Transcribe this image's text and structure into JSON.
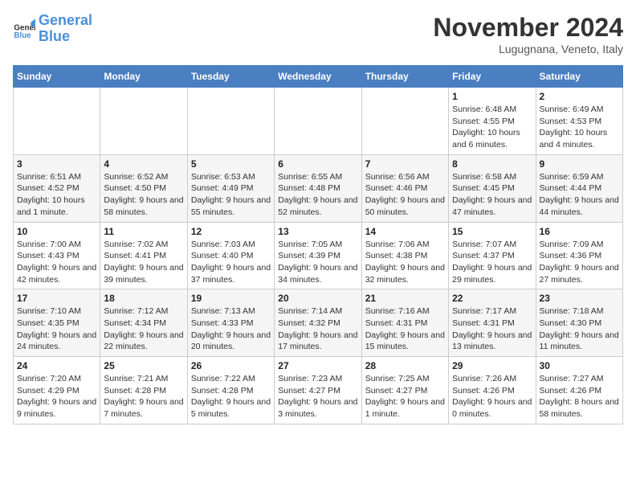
{
  "logo": {
    "text_general": "General",
    "text_blue": "Blue"
  },
  "header": {
    "month": "November 2024",
    "location": "Lugugnana, Veneto, Italy"
  },
  "weekdays": [
    "Sunday",
    "Monday",
    "Tuesday",
    "Wednesday",
    "Thursday",
    "Friday",
    "Saturday"
  ],
  "weeks": [
    [
      {
        "day": "",
        "info": ""
      },
      {
        "day": "",
        "info": ""
      },
      {
        "day": "",
        "info": ""
      },
      {
        "day": "",
        "info": ""
      },
      {
        "day": "",
        "info": ""
      },
      {
        "day": "1",
        "info": "Sunrise: 6:48 AM\nSunset: 4:55 PM\nDaylight: 10 hours and 6 minutes."
      },
      {
        "day": "2",
        "info": "Sunrise: 6:49 AM\nSunset: 4:53 PM\nDaylight: 10 hours and 4 minutes."
      }
    ],
    [
      {
        "day": "3",
        "info": "Sunrise: 6:51 AM\nSunset: 4:52 PM\nDaylight: 10 hours and 1 minute."
      },
      {
        "day": "4",
        "info": "Sunrise: 6:52 AM\nSunset: 4:50 PM\nDaylight: 9 hours and 58 minutes."
      },
      {
        "day": "5",
        "info": "Sunrise: 6:53 AM\nSunset: 4:49 PM\nDaylight: 9 hours and 55 minutes."
      },
      {
        "day": "6",
        "info": "Sunrise: 6:55 AM\nSunset: 4:48 PM\nDaylight: 9 hours and 52 minutes."
      },
      {
        "day": "7",
        "info": "Sunrise: 6:56 AM\nSunset: 4:46 PM\nDaylight: 9 hours and 50 minutes."
      },
      {
        "day": "8",
        "info": "Sunrise: 6:58 AM\nSunset: 4:45 PM\nDaylight: 9 hours and 47 minutes."
      },
      {
        "day": "9",
        "info": "Sunrise: 6:59 AM\nSunset: 4:44 PM\nDaylight: 9 hours and 44 minutes."
      }
    ],
    [
      {
        "day": "10",
        "info": "Sunrise: 7:00 AM\nSunset: 4:43 PM\nDaylight: 9 hours and 42 minutes."
      },
      {
        "day": "11",
        "info": "Sunrise: 7:02 AM\nSunset: 4:41 PM\nDaylight: 9 hours and 39 minutes."
      },
      {
        "day": "12",
        "info": "Sunrise: 7:03 AM\nSunset: 4:40 PM\nDaylight: 9 hours and 37 minutes."
      },
      {
        "day": "13",
        "info": "Sunrise: 7:05 AM\nSunset: 4:39 PM\nDaylight: 9 hours and 34 minutes."
      },
      {
        "day": "14",
        "info": "Sunrise: 7:06 AM\nSunset: 4:38 PM\nDaylight: 9 hours and 32 minutes."
      },
      {
        "day": "15",
        "info": "Sunrise: 7:07 AM\nSunset: 4:37 PM\nDaylight: 9 hours and 29 minutes."
      },
      {
        "day": "16",
        "info": "Sunrise: 7:09 AM\nSunset: 4:36 PM\nDaylight: 9 hours and 27 minutes."
      }
    ],
    [
      {
        "day": "17",
        "info": "Sunrise: 7:10 AM\nSunset: 4:35 PM\nDaylight: 9 hours and 24 minutes."
      },
      {
        "day": "18",
        "info": "Sunrise: 7:12 AM\nSunset: 4:34 PM\nDaylight: 9 hours and 22 minutes."
      },
      {
        "day": "19",
        "info": "Sunrise: 7:13 AM\nSunset: 4:33 PM\nDaylight: 9 hours and 20 minutes."
      },
      {
        "day": "20",
        "info": "Sunrise: 7:14 AM\nSunset: 4:32 PM\nDaylight: 9 hours and 17 minutes."
      },
      {
        "day": "21",
        "info": "Sunrise: 7:16 AM\nSunset: 4:31 PM\nDaylight: 9 hours and 15 minutes."
      },
      {
        "day": "22",
        "info": "Sunrise: 7:17 AM\nSunset: 4:31 PM\nDaylight: 9 hours and 13 minutes."
      },
      {
        "day": "23",
        "info": "Sunrise: 7:18 AM\nSunset: 4:30 PM\nDaylight: 9 hours and 11 minutes."
      }
    ],
    [
      {
        "day": "24",
        "info": "Sunrise: 7:20 AM\nSunset: 4:29 PM\nDaylight: 9 hours and 9 minutes."
      },
      {
        "day": "25",
        "info": "Sunrise: 7:21 AM\nSunset: 4:28 PM\nDaylight: 9 hours and 7 minutes."
      },
      {
        "day": "26",
        "info": "Sunrise: 7:22 AM\nSunset: 4:28 PM\nDaylight: 9 hours and 5 minutes."
      },
      {
        "day": "27",
        "info": "Sunrise: 7:23 AM\nSunset: 4:27 PM\nDaylight: 9 hours and 3 minutes."
      },
      {
        "day": "28",
        "info": "Sunrise: 7:25 AM\nSunset: 4:27 PM\nDaylight: 9 hours and 1 minute."
      },
      {
        "day": "29",
        "info": "Sunrise: 7:26 AM\nSunset: 4:26 PM\nDaylight: 9 hours and 0 minutes."
      },
      {
        "day": "30",
        "info": "Sunrise: 7:27 AM\nSunset: 4:26 PM\nDaylight: 8 hours and 58 minutes."
      }
    ]
  ]
}
